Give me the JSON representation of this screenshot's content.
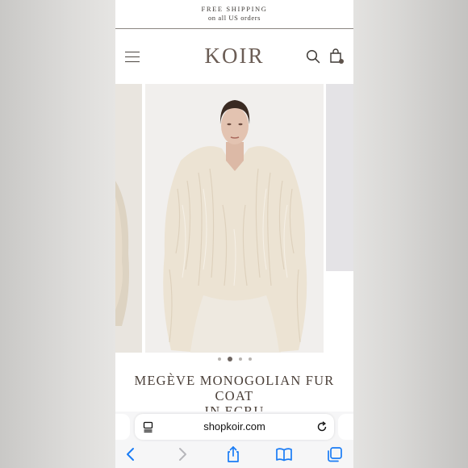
{
  "promo": {
    "line1": "FREE SHIPPING",
    "line2": "on all US orders"
  },
  "header": {
    "logo": "KOIR",
    "icons": [
      "menu-icon",
      "search-icon",
      "shopping-bag-icon"
    ]
  },
  "gallery": {
    "slide_count": 4,
    "active_index": 1,
    "zoom_icon": "magnifier-icon"
  },
  "product": {
    "title_line1": "MEGÈVE MONOGOLIAN FUR COAT",
    "title_line2": "IN ECRU"
  },
  "browser": {
    "url": "shopkoir.com",
    "toolbar_icons": [
      "back-icon",
      "forward-icon",
      "share-icon",
      "bookmarks-icon",
      "tabs-icon"
    ]
  },
  "colors": {
    "logo": "#6b5d55",
    "title": "#4a3f38",
    "ios_blue": "#1a7cf5"
  }
}
